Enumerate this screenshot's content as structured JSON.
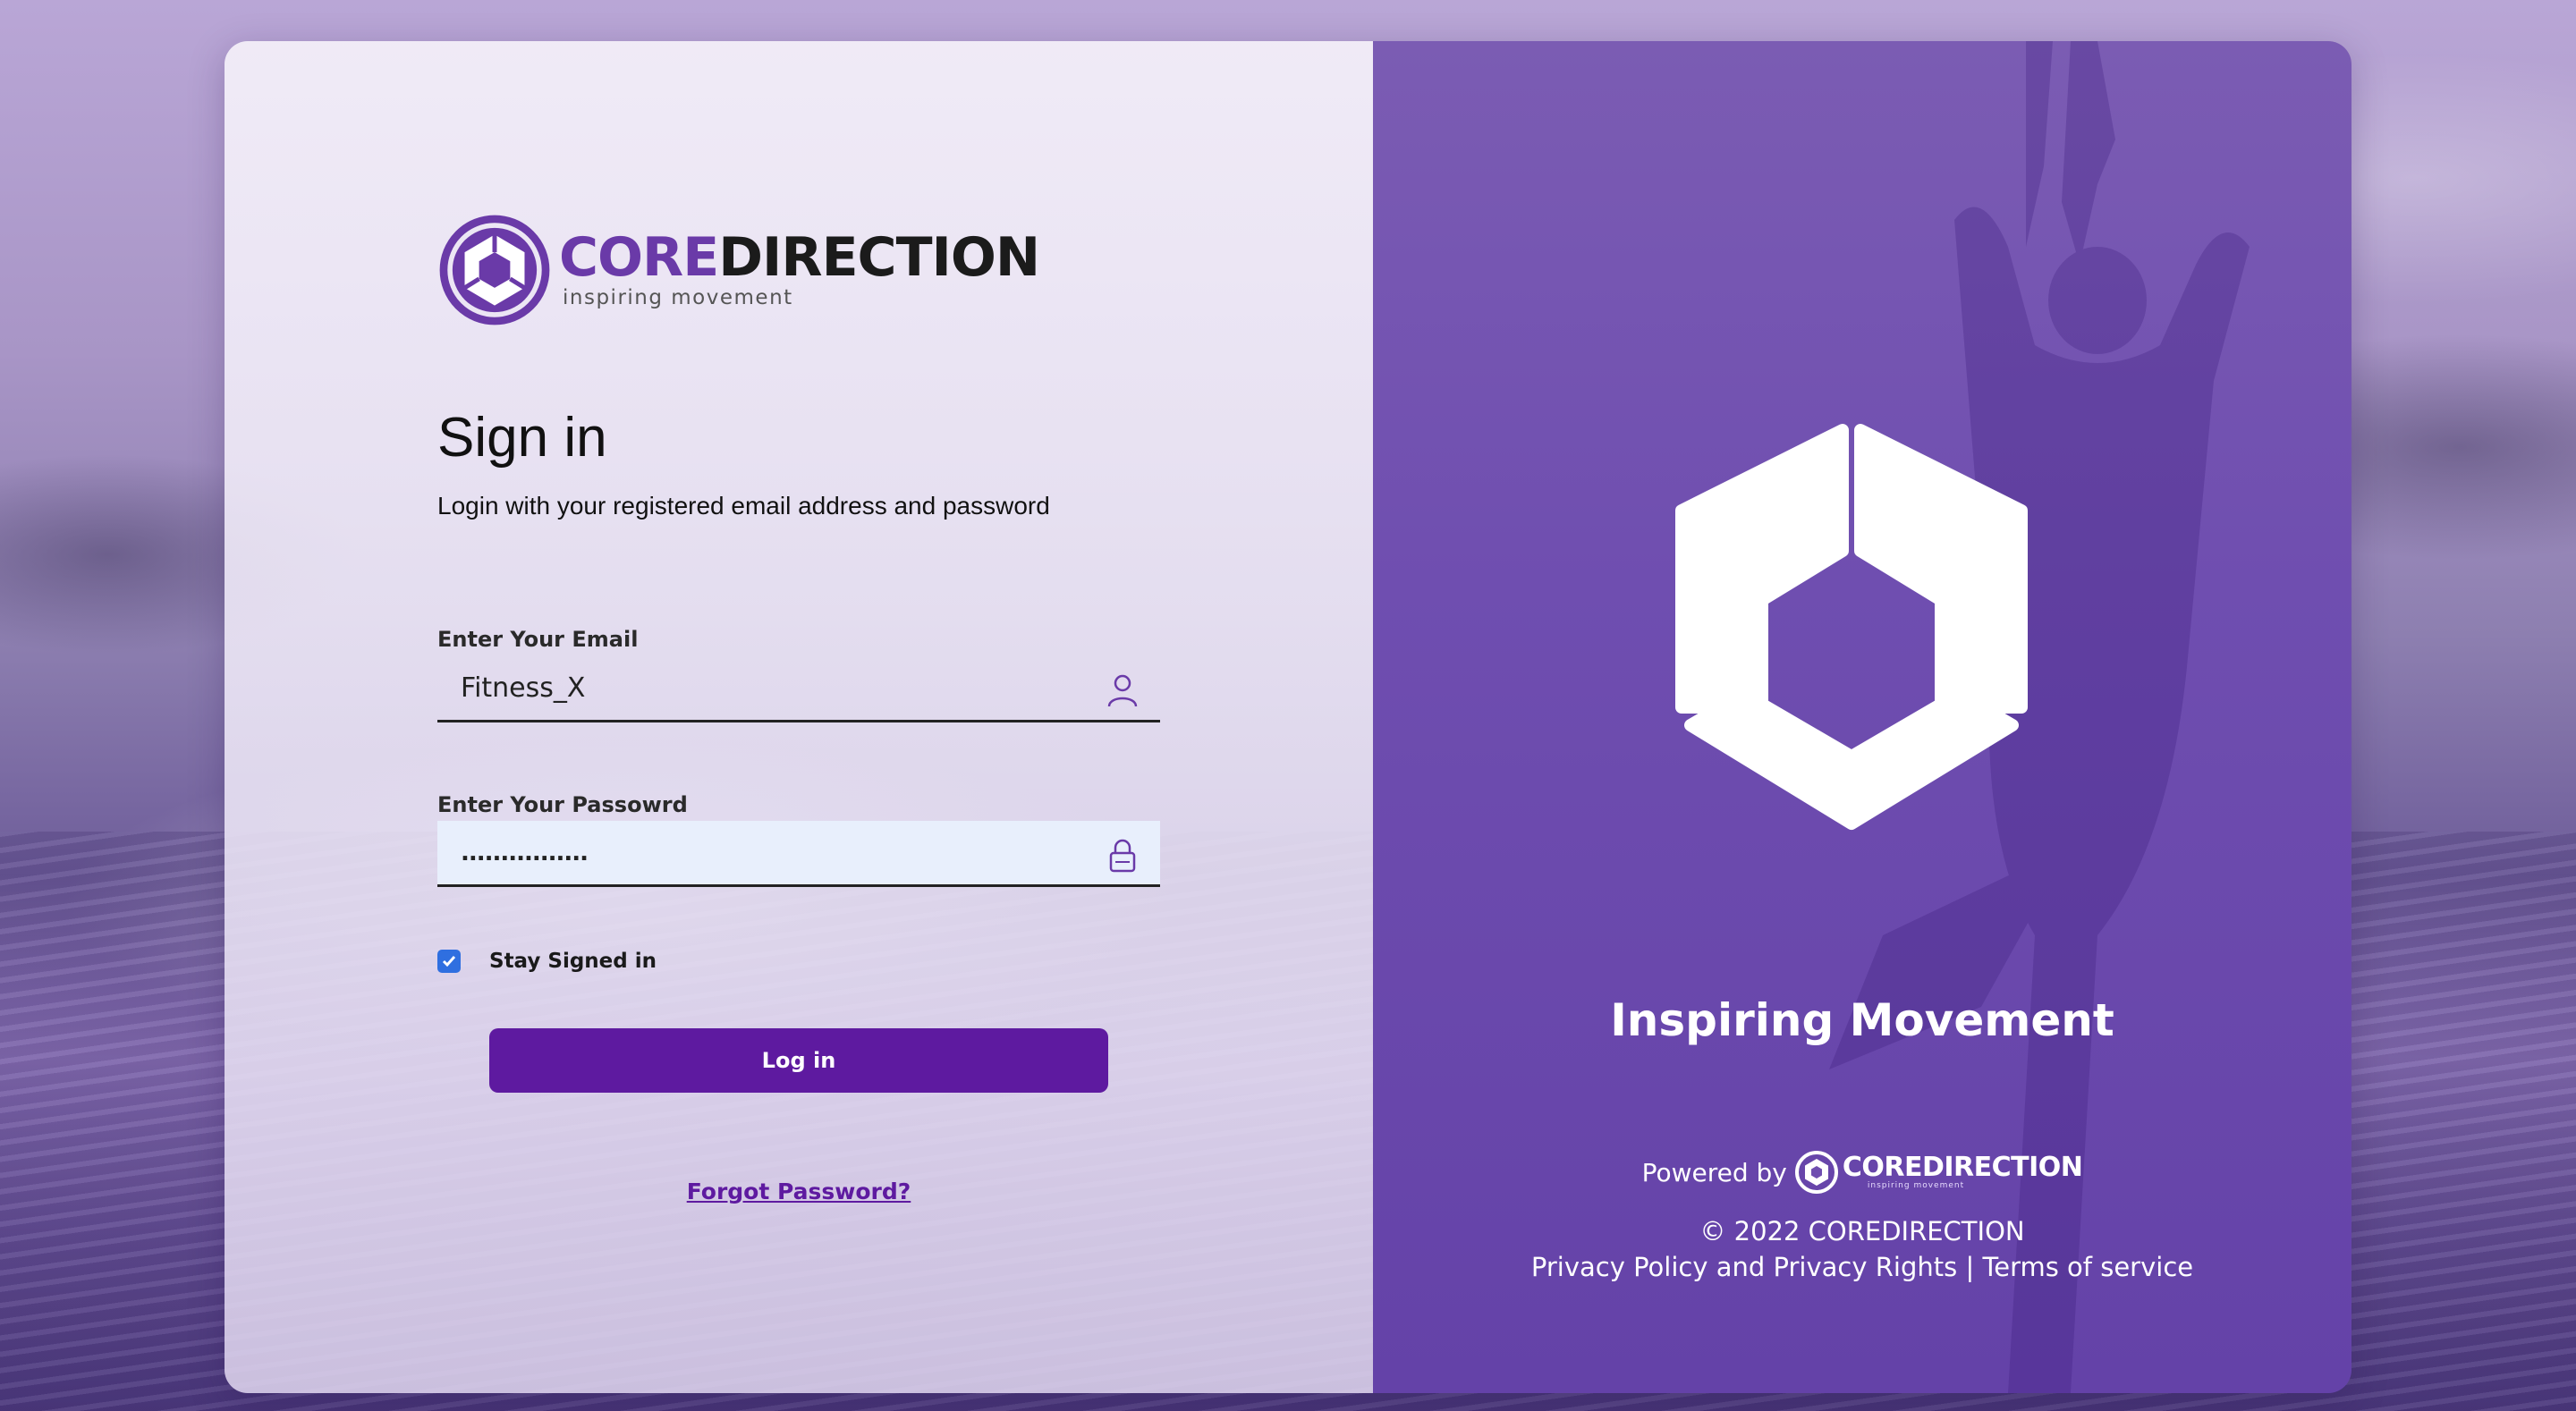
{
  "logo": {
    "word_core": "CORE",
    "word_direction": "DIRECTION",
    "tagline": "inspiring movement"
  },
  "signin": {
    "title": "Sign in",
    "subtitle": "Login with your registered email address and password",
    "email_label": "Enter Your Email",
    "email_value": "Fitness_X",
    "password_label": "Enter Your Passowrd",
    "password_value": "................",
    "stay_signed_in_label": "Stay Signed in",
    "stay_signed_in_checked": true,
    "login_button": "Log in",
    "forgot_password": "Forgot Password?"
  },
  "brand_panel": {
    "tagline": "Inspiring Movement",
    "powered_by": "Powered by",
    "powered_logo_name": "COREDIRECTION",
    "powered_logo_tag": "inspiring movement",
    "copyright": "© 2022 COREDIRECTION",
    "privacy_link": "Privacy Policy and Privacy Rights",
    "separator": "|",
    "terms_link": "Terms of service"
  },
  "colors": {
    "brand_purple": "#5e1aa0",
    "panel_purple": "#6f4eb0",
    "checkbox_blue": "#2f6fe0"
  },
  "icons": {
    "email": "user-icon",
    "password": "lock-icon"
  }
}
